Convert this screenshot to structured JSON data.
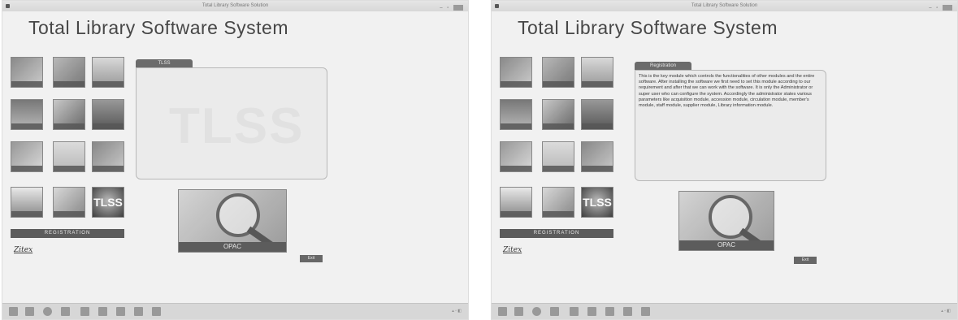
{
  "screens": [
    {
      "id": "left",
      "window_title": "Total Library Software Solution",
      "app_title": "Total Library Software System",
      "tab_label": "TLSS",
      "info_text": "",
      "watermark": "TLSS",
      "tile_logo_text": "TLSS",
      "registration_label": "REGISTRATION",
      "opac_label": "OPAC",
      "exit_label": "Exit",
      "logo_text": "Zitex"
    },
    {
      "id": "right",
      "window_title": "Total Library Software Solution",
      "app_title": "Total Library Software System",
      "tab_label": "Registration",
      "info_text": "This is the key module which controls the functionalities of other modules and the entire software. After installing the software we first need to set this module according to our requirement and after that we can work with the software. It is only the Administrator or super user who can configure the system. Accordingly the administrator states various parameters like acquisition module, accession module, circulation module, member's module, staff module, supplier module, Library information module.",
      "watermark": "",
      "tile_logo_text": "TLSS",
      "registration_label": "REGISTRATION",
      "opac_label": "OPAC",
      "exit_label": "Exit",
      "logo_text": "Zitex"
    }
  ],
  "tile_icons": [
    "book-icon",
    "building-icon",
    "shelf-icon",
    "computer-icon",
    "people-icon",
    "stack-icon",
    "bookshelf-icon",
    "library-icon",
    "reader-icon",
    "feather-icon",
    "report-icon",
    "tlss-logo-icon"
  ],
  "taskbar_icons": [
    "start-icon",
    "explorer-icon",
    "ie-icon",
    "app-icon",
    "search-icon",
    "folder-icon",
    "pen-icon",
    "media-icon",
    "k7-icon"
  ],
  "colors": {
    "panel_bg": "#f7f7f7",
    "tile_dark": "#555555",
    "accent": "#5a5a5a"
  }
}
